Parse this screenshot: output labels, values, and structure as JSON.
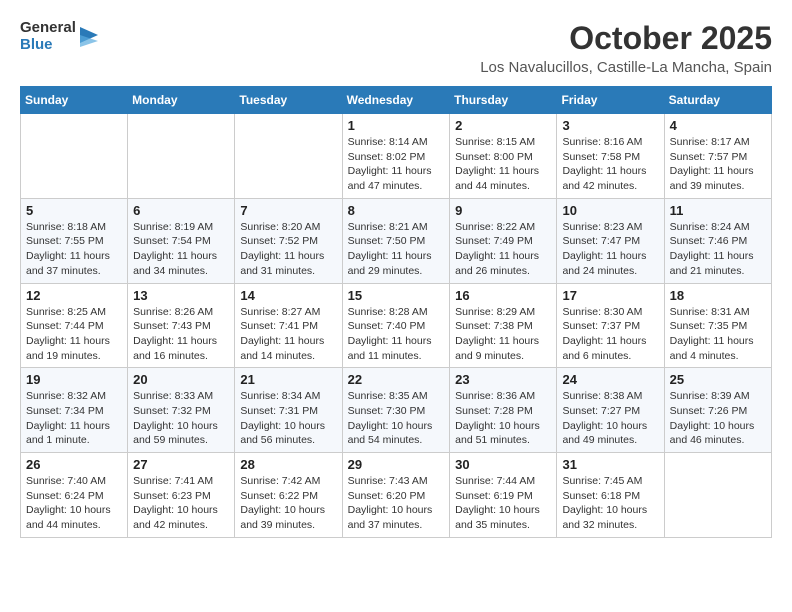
{
  "logo": {
    "text_general": "General",
    "text_blue": "Blue"
  },
  "title": "October 2025",
  "location": "Los Navalucillos, Castille-La Mancha, Spain",
  "weekdays": [
    "Sunday",
    "Monday",
    "Tuesday",
    "Wednesday",
    "Thursday",
    "Friday",
    "Saturday"
  ],
  "weeks": [
    [
      {
        "day": "",
        "sunrise": "",
        "sunset": "",
        "daylight": ""
      },
      {
        "day": "",
        "sunrise": "",
        "sunset": "",
        "daylight": ""
      },
      {
        "day": "",
        "sunrise": "",
        "sunset": "",
        "daylight": ""
      },
      {
        "day": "1",
        "sunrise": "Sunrise: 8:14 AM",
        "sunset": "Sunset: 8:02 PM",
        "daylight": "Daylight: 11 hours and 47 minutes."
      },
      {
        "day": "2",
        "sunrise": "Sunrise: 8:15 AM",
        "sunset": "Sunset: 8:00 PM",
        "daylight": "Daylight: 11 hours and 44 minutes."
      },
      {
        "day": "3",
        "sunrise": "Sunrise: 8:16 AM",
        "sunset": "Sunset: 7:58 PM",
        "daylight": "Daylight: 11 hours and 42 minutes."
      },
      {
        "day": "4",
        "sunrise": "Sunrise: 8:17 AM",
        "sunset": "Sunset: 7:57 PM",
        "daylight": "Daylight: 11 hours and 39 minutes."
      }
    ],
    [
      {
        "day": "5",
        "sunrise": "Sunrise: 8:18 AM",
        "sunset": "Sunset: 7:55 PM",
        "daylight": "Daylight: 11 hours and 37 minutes."
      },
      {
        "day": "6",
        "sunrise": "Sunrise: 8:19 AM",
        "sunset": "Sunset: 7:54 PM",
        "daylight": "Daylight: 11 hours and 34 minutes."
      },
      {
        "day": "7",
        "sunrise": "Sunrise: 8:20 AM",
        "sunset": "Sunset: 7:52 PM",
        "daylight": "Daylight: 11 hours and 31 minutes."
      },
      {
        "day": "8",
        "sunrise": "Sunrise: 8:21 AM",
        "sunset": "Sunset: 7:50 PM",
        "daylight": "Daylight: 11 hours and 29 minutes."
      },
      {
        "day": "9",
        "sunrise": "Sunrise: 8:22 AM",
        "sunset": "Sunset: 7:49 PM",
        "daylight": "Daylight: 11 hours and 26 minutes."
      },
      {
        "day": "10",
        "sunrise": "Sunrise: 8:23 AM",
        "sunset": "Sunset: 7:47 PM",
        "daylight": "Daylight: 11 hours and 24 minutes."
      },
      {
        "day": "11",
        "sunrise": "Sunrise: 8:24 AM",
        "sunset": "Sunset: 7:46 PM",
        "daylight": "Daylight: 11 hours and 21 minutes."
      }
    ],
    [
      {
        "day": "12",
        "sunrise": "Sunrise: 8:25 AM",
        "sunset": "Sunset: 7:44 PM",
        "daylight": "Daylight: 11 hours and 19 minutes."
      },
      {
        "day": "13",
        "sunrise": "Sunrise: 8:26 AM",
        "sunset": "Sunset: 7:43 PM",
        "daylight": "Daylight: 11 hours and 16 minutes."
      },
      {
        "day": "14",
        "sunrise": "Sunrise: 8:27 AM",
        "sunset": "Sunset: 7:41 PM",
        "daylight": "Daylight: 11 hours and 14 minutes."
      },
      {
        "day": "15",
        "sunrise": "Sunrise: 8:28 AM",
        "sunset": "Sunset: 7:40 PM",
        "daylight": "Daylight: 11 hours and 11 minutes."
      },
      {
        "day": "16",
        "sunrise": "Sunrise: 8:29 AM",
        "sunset": "Sunset: 7:38 PM",
        "daylight": "Daylight: 11 hours and 9 minutes."
      },
      {
        "day": "17",
        "sunrise": "Sunrise: 8:30 AM",
        "sunset": "Sunset: 7:37 PM",
        "daylight": "Daylight: 11 hours and 6 minutes."
      },
      {
        "day": "18",
        "sunrise": "Sunrise: 8:31 AM",
        "sunset": "Sunset: 7:35 PM",
        "daylight": "Daylight: 11 hours and 4 minutes."
      }
    ],
    [
      {
        "day": "19",
        "sunrise": "Sunrise: 8:32 AM",
        "sunset": "Sunset: 7:34 PM",
        "daylight": "Daylight: 11 hours and 1 minute."
      },
      {
        "day": "20",
        "sunrise": "Sunrise: 8:33 AM",
        "sunset": "Sunset: 7:32 PM",
        "daylight": "Daylight: 10 hours and 59 minutes."
      },
      {
        "day": "21",
        "sunrise": "Sunrise: 8:34 AM",
        "sunset": "Sunset: 7:31 PM",
        "daylight": "Daylight: 10 hours and 56 minutes."
      },
      {
        "day": "22",
        "sunrise": "Sunrise: 8:35 AM",
        "sunset": "Sunset: 7:30 PM",
        "daylight": "Daylight: 10 hours and 54 minutes."
      },
      {
        "day": "23",
        "sunrise": "Sunrise: 8:36 AM",
        "sunset": "Sunset: 7:28 PM",
        "daylight": "Daylight: 10 hours and 51 minutes."
      },
      {
        "day": "24",
        "sunrise": "Sunrise: 8:38 AM",
        "sunset": "Sunset: 7:27 PM",
        "daylight": "Daylight: 10 hours and 49 minutes."
      },
      {
        "day": "25",
        "sunrise": "Sunrise: 8:39 AM",
        "sunset": "Sunset: 7:26 PM",
        "daylight": "Daylight: 10 hours and 46 minutes."
      }
    ],
    [
      {
        "day": "26",
        "sunrise": "Sunrise: 7:40 AM",
        "sunset": "Sunset: 6:24 PM",
        "daylight": "Daylight: 10 hours and 44 minutes."
      },
      {
        "day": "27",
        "sunrise": "Sunrise: 7:41 AM",
        "sunset": "Sunset: 6:23 PM",
        "daylight": "Daylight: 10 hours and 42 minutes."
      },
      {
        "day": "28",
        "sunrise": "Sunrise: 7:42 AM",
        "sunset": "Sunset: 6:22 PM",
        "daylight": "Daylight: 10 hours and 39 minutes."
      },
      {
        "day": "29",
        "sunrise": "Sunrise: 7:43 AM",
        "sunset": "Sunset: 6:20 PM",
        "daylight": "Daylight: 10 hours and 37 minutes."
      },
      {
        "day": "30",
        "sunrise": "Sunrise: 7:44 AM",
        "sunset": "Sunset: 6:19 PM",
        "daylight": "Daylight: 10 hours and 35 minutes."
      },
      {
        "day": "31",
        "sunrise": "Sunrise: 7:45 AM",
        "sunset": "Sunset: 6:18 PM",
        "daylight": "Daylight: 10 hours and 32 minutes."
      },
      {
        "day": "",
        "sunrise": "",
        "sunset": "",
        "daylight": ""
      }
    ]
  ]
}
